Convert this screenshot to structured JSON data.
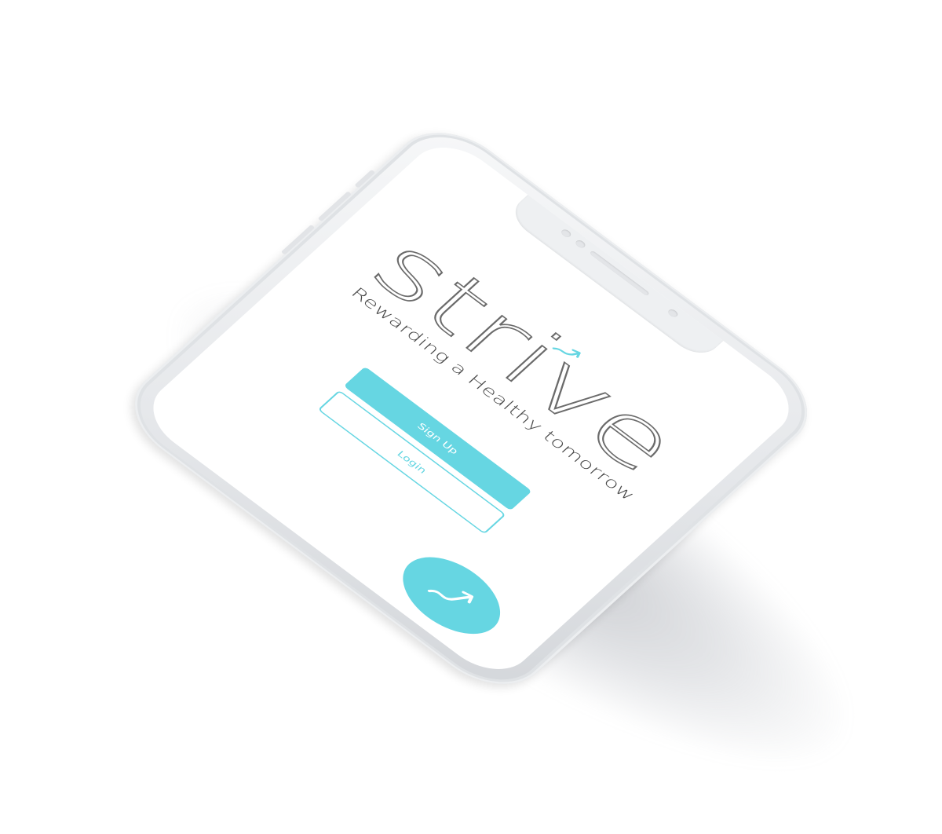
{
  "app": {
    "name": "strive",
    "tagline": "Rewarding a Healthy tomorrow"
  },
  "actions": {
    "signup_label": "Sign Up",
    "login_label": "Login"
  },
  "theme": {
    "accent": "#66d6e2",
    "logo_text_color": "#6b6b6b",
    "background": "#ffffff",
    "phone_frame": "#e6e8eb"
  },
  "icons": {
    "fab": "trend-arrow-icon",
    "logo_accent": "trend-arrow-icon"
  }
}
